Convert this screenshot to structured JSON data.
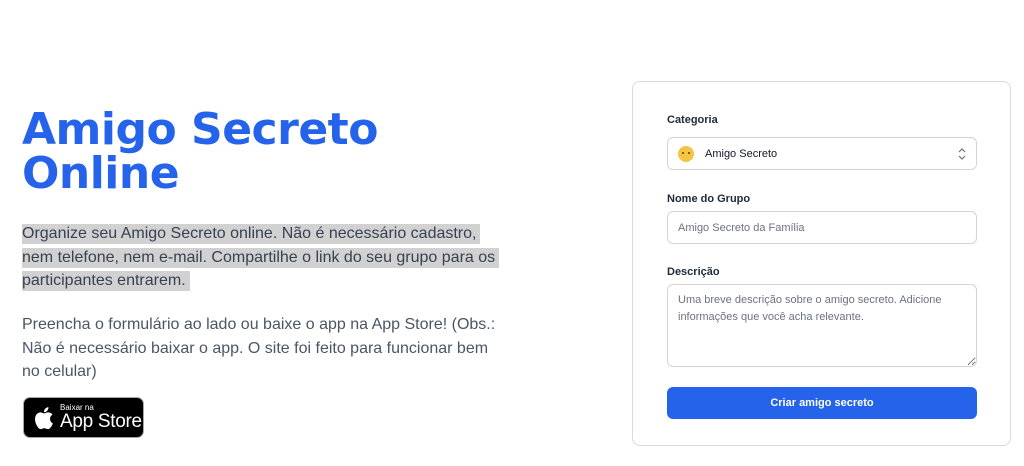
{
  "hero": {
    "title_line1": "Amigo Secreto",
    "title_line2": "Online",
    "intro": "Organize seu Amigo Secreto online. Não é necessário cadastro, nem telefone, nem e-mail. Compartilhe o link do seu grupo para os participantes entrarem.",
    "note": "Preencha o formulário ao lado ou baixe o app na App Store! (Obs.: Não é necessário baixar o app. O site foi feito para funcionar bem no celular)"
  },
  "app_store_badge": {
    "small_text": "Baixar na",
    "big_text": "App Store",
    "icon": "apple-icon"
  },
  "form": {
    "category_label": "Categoria",
    "category_value": "Amigo Secreto",
    "category_icon": "shushing-face-emoji",
    "group_name_label": "Nome do Grupo",
    "group_name_placeholder": "Amigo Secreto da Família",
    "description_label": "Descrição",
    "description_placeholder": "Uma breve descrição sobre o amigo secreto. Adicione informações que você acha relevante.",
    "submit_label": "Criar amigo secreto"
  },
  "colors": {
    "brand": "#2563eb",
    "highlight": "#d1d1d1"
  }
}
